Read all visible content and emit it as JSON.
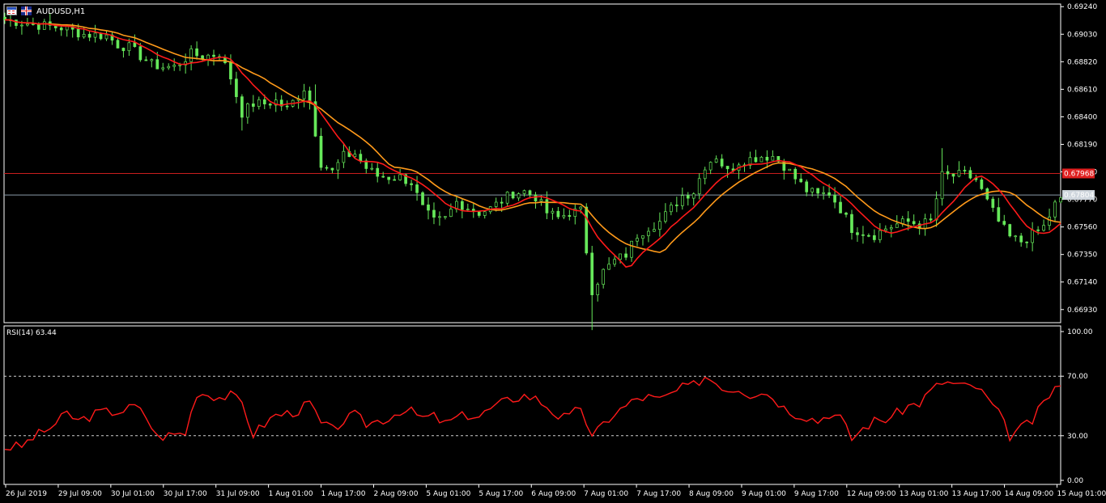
{
  "symbol": "AUDUSD,H1",
  "rsi_label": "RSI(14) 63.44",
  "colors": {
    "candle": "#66e85a",
    "ma_fast": "#ff1a1a",
    "ma_slow": "#ff9a1a",
    "rsi": "#ff1a1a",
    "hline_red": "#c81e1e",
    "hline_bid": "#8a9aa8",
    "bid_tag_bg": "#cfd6dd",
    "price_tag_bg": "#e02020"
  },
  "price_axis": [
    "0.69240",
    "0.69030",
    "0.68820",
    "0.68610",
    "0.68400",
    "0.68190",
    "0.67980",
    "0.67770",
    "0.67560",
    "0.67350",
    "0.67140",
    "0.66930"
  ],
  "price_tags": {
    "level": "0.67968",
    "bid": "0.67804"
  },
  "rsi_axis": [
    "100.00",
    "70.00",
    "30.00",
    "0.00"
  ],
  "time_axis": [
    "26 Jul 2019",
    "29 Jul 09:00",
    "30 Jul 01:00",
    "30 Jul 17:00",
    "31 Jul 09:00",
    "1 Aug 01:00",
    "1 Aug 17:00",
    "2 Aug 09:00",
    "5 Aug 01:00",
    "5 Aug 17:00",
    "6 Aug 09:00",
    "7 Aug 01:00",
    "7 Aug 17:00",
    "8 Aug 09:00",
    "9 Aug 01:00",
    "9 Aug 17:00",
    "12 Aug 09:00",
    "13 Aug 01:00",
    "13 Aug 17:00",
    "14 Aug 09:00",
    "15 Aug 01:00"
  ],
  "chart_data": [
    {
      "type": "candlestick",
      "symbol": "AUDUSD",
      "timeframe": "H1",
      "ylim": [
        0.6683,
        0.6926
      ],
      "horizontal_lines": [
        0.67968,
        0.67804
      ],
      "close_path": [
        [
          0,
          0.6914
        ],
        [
          6,
          0.691
        ],
        [
          10,
          0.6908
        ],
        [
          14,
          0.6903
        ],
        [
          18,
          0.6902
        ],
        [
          20,
          0.6895
        ],
        [
          22,
          0.6893
        ],
        [
          26,
          0.688
        ],
        [
          28,
          0.6878
        ],
        [
          30,
          0.6878
        ],
        [
          33,
          0.6888
        ],
        [
          35,
          0.6886
        ],
        [
          38,
          0.6888
        ],
        [
          40,
          0.687
        ],
        [
          42,
          0.6843
        ],
        [
          44,
          0.685
        ],
        [
          46,
          0.685
        ],
        [
          48,
          0.6852
        ],
        [
          50,
          0.6846
        ],
        [
          53,
          0.6862
        ],
        [
          54,
          0.6852
        ],
        [
          56,
          0.6805
        ],
        [
          58,
          0.6798
        ],
        [
          60,
          0.681
        ],
        [
          62,
          0.6812
        ],
        [
          64,
          0.6801
        ],
        [
          66,
          0.6795
        ],
        [
          68,
          0.6794
        ],
        [
          70,
          0.6794
        ],
        [
          72,
          0.679
        ],
        [
          74,
          0.677
        ],
        [
          76,
          0.676
        ],
        [
          78,
          0.6762
        ],
        [
          80,
          0.6775
        ],
        [
          82,
          0.6771
        ],
        [
          84,
          0.6767
        ],
        [
          86,
          0.677
        ],
        [
          88,
          0.6776
        ],
        [
          90,
          0.6782
        ],
        [
          92,
          0.6783
        ],
        [
          94,
          0.6779
        ],
        [
          96,
          0.6767
        ],
        [
          98,
          0.6763
        ],
        [
          100,
          0.6767
        ],
        [
          102,
          0.6768
        ],
        [
          104,
          0.6708
        ],
        [
          106,
          0.6722
        ],
        [
          108,
          0.673
        ],
        [
          110,
          0.6735
        ],
        [
          112,
          0.675
        ],
        [
          114,
          0.6756
        ],
        [
          116,
          0.676
        ],
        [
          118,
          0.677
        ],
        [
          120,
          0.678
        ],
        [
          122,
          0.6783
        ],
        [
          124,
          0.6803
        ],
        [
          126,
          0.681
        ],
        [
          128,
          0.6798
        ],
        [
          130,
          0.6806
        ],
        [
          132,
          0.6808
        ],
        [
          134,
          0.681
        ],
        [
          136,
          0.681
        ],
        [
          138,
          0.6803
        ],
        [
          140,
          0.6793
        ],
        [
          142,
          0.6784
        ],
        [
          144,
          0.678
        ],
        [
          146,
          0.6782
        ],
        [
          148,
          0.677
        ],
        [
          150,
          0.6755
        ],
        [
          152,
          0.6752
        ],
        [
          154,
          0.675
        ],
        [
          156,
          0.6755
        ],
        [
          158,
          0.6758
        ],
        [
          160,
          0.676
        ],
        [
          162,
          0.6758
        ],
        [
          164,
          0.676
        ],
        [
          166,
          0.6795
        ],
        [
          168,
          0.6795
        ],
        [
          170,
          0.6796
        ],
        [
          172,
          0.6792
        ],
        [
          174,
          0.6775
        ],
        [
          176,
          0.676
        ],
        [
          178,
          0.6748
        ],
        [
          180,
          0.6745
        ],
        [
          182,
          0.675
        ],
        [
          184,
          0.6756
        ],
        [
          186,
          0.6773
        ],
        [
          187,
          0.6776
        ]
      ]
    },
    {
      "type": "line",
      "name": "RSI(14)",
      "ylim": [
        0,
        100
      ],
      "levels": [
        70,
        30
      ],
      "last": 63.44,
      "values": [
        [
          0,
          22
        ],
        [
          3,
          23
        ],
        [
          5,
          29
        ],
        [
          7,
          33
        ],
        [
          9,
          38
        ],
        [
          11,
          45
        ],
        [
          13,
          40
        ],
        [
          15,
          43
        ],
        [
          17,
          46
        ],
        [
          19,
          46
        ],
        [
          21,
          47
        ],
        [
          23,
          50
        ],
        [
          25,
          43
        ],
        [
          27,
          29
        ],
        [
          30,
          31
        ],
        [
          32,
          32
        ],
        [
          34,
          59
        ],
        [
          36,
          58
        ],
        [
          38,
          56
        ],
        [
          40,
          57
        ],
        [
          42,
          52
        ],
        [
          44,
          31
        ],
        [
          46,
          38
        ],
        [
          48,
          44
        ],
        [
          50,
          45
        ],
        [
          52,
          47
        ],
        [
          54,
          52
        ],
        [
          56,
          38
        ],
        [
          58,
          34
        ],
        [
          60,
          40
        ],
        [
          62,
          44
        ],
        [
          64,
          38
        ],
        [
          66,
          40
        ],
        [
          68,
          42
        ],
        [
          70,
          47
        ],
        [
          72,
          46
        ],
        [
          74,
          42
        ],
        [
          76,
          43
        ],
        [
          78,
          38
        ],
        [
          80,
          42
        ],
        [
          82,
          44
        ],
        [
          84,
          43
        ],
        [
          86,
          48
        ],
        [
          88,
          52
        ],
        [
          90,
          55
        ],
        [
          92,
          57
        ],
        [
          94,
          55
        ],
        [
          96,
          50
        ],
        [
          98,
          43
        ],
        [
          100,
          42
        ],
        [
          102,
          50
        ],
        [
          104,
          28
        ],
        [
          106,
          38
        ],
        [
          108,
          45
        ],
        [
          110,
          50
        ],
        [
          112,
          55
        ],
        [
          114,
          56
        ],
        [
          116,
          54
        ],
        [
          118,
          58
        ],
        [
          120,
          62
        ],
        [
          122,
          64
        ],
        [
          124,
          70
        ],
        [
          126,
          66
        ],
        [
          128,
          61
        ],
        [
          130,
          62
        ],
        [
          132,
          58
        ],
        [
          134,
          60
        ],
        [
          136,
          56
        ],
        [
          138,
          49
        ],
        [
          140,
          45
        ],
        [
          142,
          43
        ],
        [
          144,
          40
        ],
        [
          146,
          45
        ],
        [
          148,
          42
        ],
        [
          150,
          28
        ],
        [
          152,
          35
        ],
        [
          154,
          40
        ],
        [
          156,
          41
        ],
        [
          158,
          45
        ],
        [
          160,
          50
        ],
        [
          162,
          52
        ],
        [
          164,
          60
        ],
        [
          166,
          66
        ],
        [
          168,
          65
        ],
        [
          170,
          63
        ],
        [
          172,
          63
        ],
        [
          174,
          55
        ],
        [
          176,
          45
        ],
        [
          178,
          30
        ],
        [
          180,
          35
        ],
        [
          182,
          40
        ],
        [
          184,
          52
        ],
        [
          186,
          63
        ],
        [
          187,
          64
        ]
      ]
    }
  ]
}
